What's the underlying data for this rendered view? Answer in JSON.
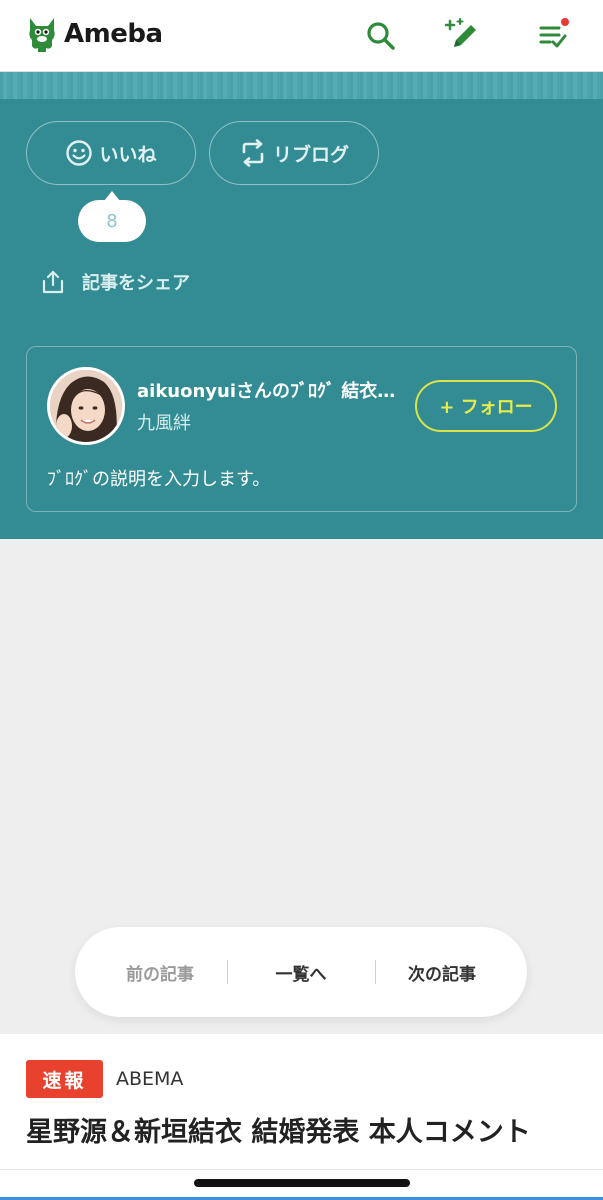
{
  "header": {
    "logo_text": "Ameba",
    "icons": [
      "search-icon",
      "write-icon",
      "feed-icon"
    ],
    "brand_color": "#2e8b3a",
    "notification_color": "#e53935"
  },
  "actions": {
    "like_label": "いいね",
    "reblog_label": "リブログ",
    "like_count": "8",
    "share_label": "記事をシェア"
  },
  "profile": {
    "blog_title": "aikuonyuiさんのﾌﾞﾛｸﾞ 結衣…",
    "author": "九風絆",
    "follow_label": "+ フォロー",
    "description": "ﾌﾞﾛｸﾞの説明を入力します。"
  },
  "pager": {
    "prev": "前の記事",
    "list": "一覧へ",
    "next": "次の記事"
  },
  "news": {
    "badge": "速報",
    "source": "ABEMA",
    "headline": "星野源＆新垣結衣 結婚発表 本人コメント"
  },
  "colors": {
    "teal": "#338c93",
    "follow_accent": "#dbe34a",
    "badge": "#e8412e"
  }
}
